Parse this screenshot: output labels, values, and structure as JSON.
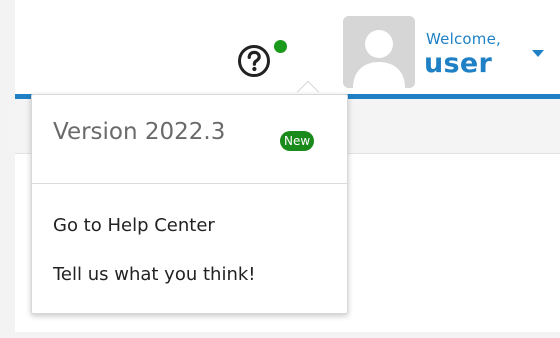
{
  "header": {
    "help_icon": "question-circle-icon",
    "notification_dot_color": "#1a9a1a",
    "welcome_label": "Welcome,",
    "username": "user",
    "caret_icon": "caret-down-icon",
    "accent_color": "#1f80c6"
  },
  "help_popover": {
    "version_label": "Version 2022.3",
    "new_badge": "New",
    "new_badge_color": "#1a8a1a",
    "menu_items": [
      {
        "label": "Go to Help Center"
      },
      {
        "label": "Tell us what you think!"
      }
    ]
  }
}
